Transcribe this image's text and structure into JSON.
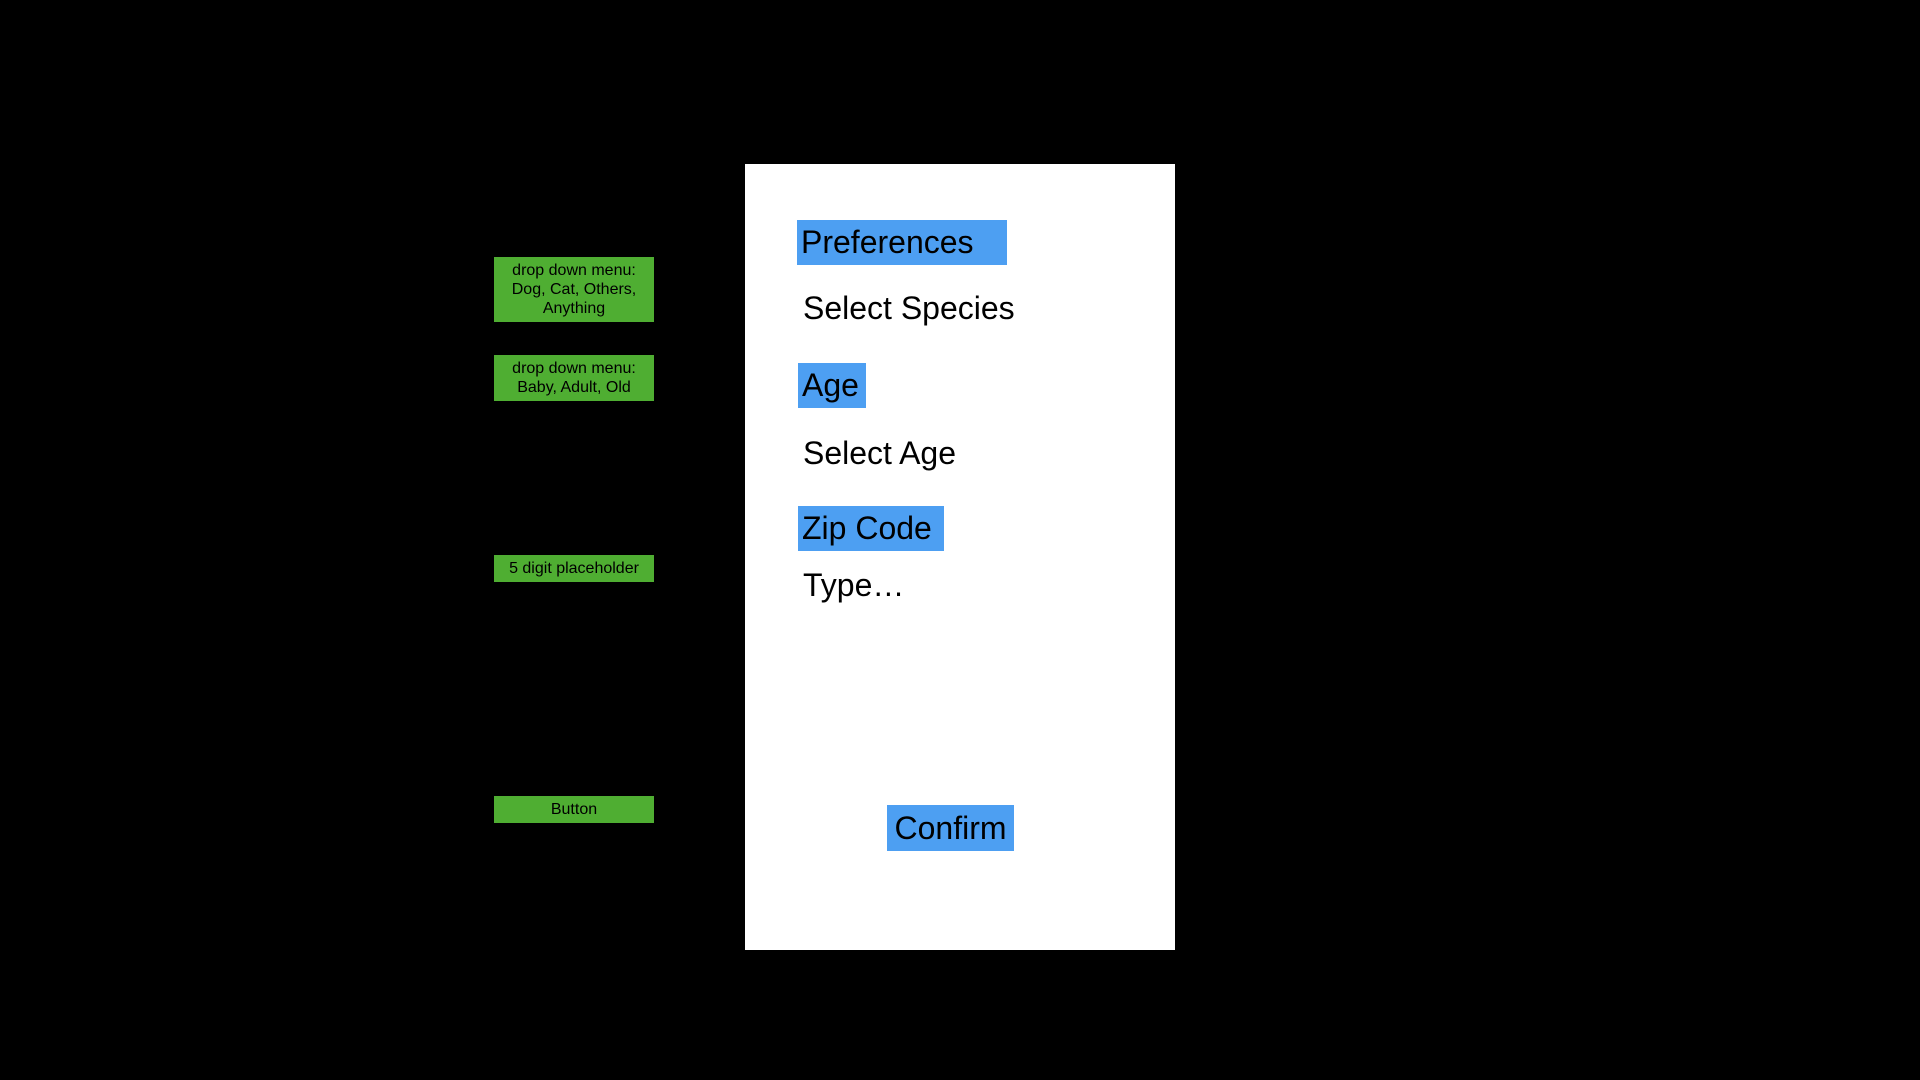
{
  "annotations": {
    "species_note": "drop down menu: Dog, Cat, Others, Anything",
    "age_note": "drop down menu: Baby, Adult, Old",
    "zip_note": "5 digit placeholder",
    "button_note": "Button"
  },
  "form": {
    "preferences_heading": "Preferences",
    "species_select_value": "Select Species",
    "age_heading": "Age",
    "age_select_value": "Select Age",
    "zip_heading": "Zip Code",
    "zip_placeholder": "Type…",
    "confirm_label": "Confirm"
  },
  "colors": {
    "background": "#000000",
    "card": "#ffffff",
    "heading_highlight": "#4d9ff2",
    "annotation_note": "#4fae32"
  }
}
